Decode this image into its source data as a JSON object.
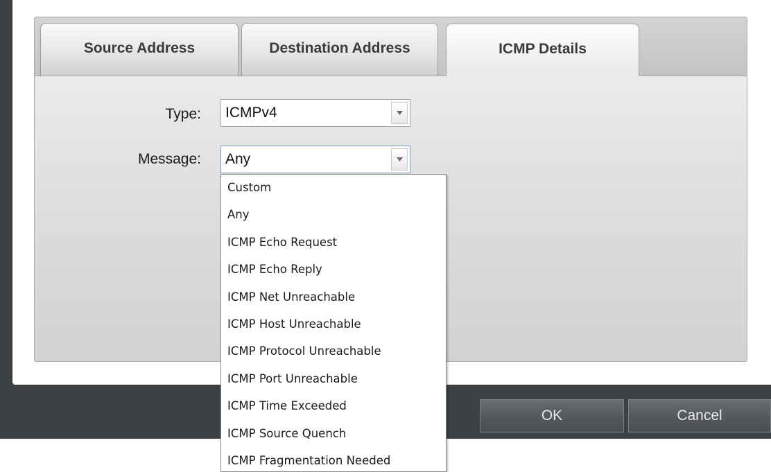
{
  "tabs": [
    {
      "label": "Source Address",
      "active": false
    },
    {
      "label": "Destination Address",
      "active": false
    },
    {
      "label": "ICMP Details",
      "active": true
    }
  ],
  "form": {
    "type_label": "Type:",
    "type_value": "ICMPv4",
    "message_label": "Message:",
    "message_value": "Any"
  },
  "message_options": [
    "Custom",
    "Any",
    "ICMP Echo Request",
    "ICMP Echo Reply",
    "ICMP Net Unreachable",
    "ICMP Host Unreachable",
    "ICMP Protocol Unreachable",
    "ICMP Port Unreachable",
    "ICMP Time Exceeded",
    "ICMP Source Quench",
    "ICMP Fragmentation Needed"
  ],
  "buttons": {
    "ok": "OK",
    "cancel": "Cancel"
  },
  "icons": {
    "combo_arrow": "chevron-down-icon"
  },
  "colors": {
    "frame": "#3d4043",
    "button": "#55585c"
  }
}
